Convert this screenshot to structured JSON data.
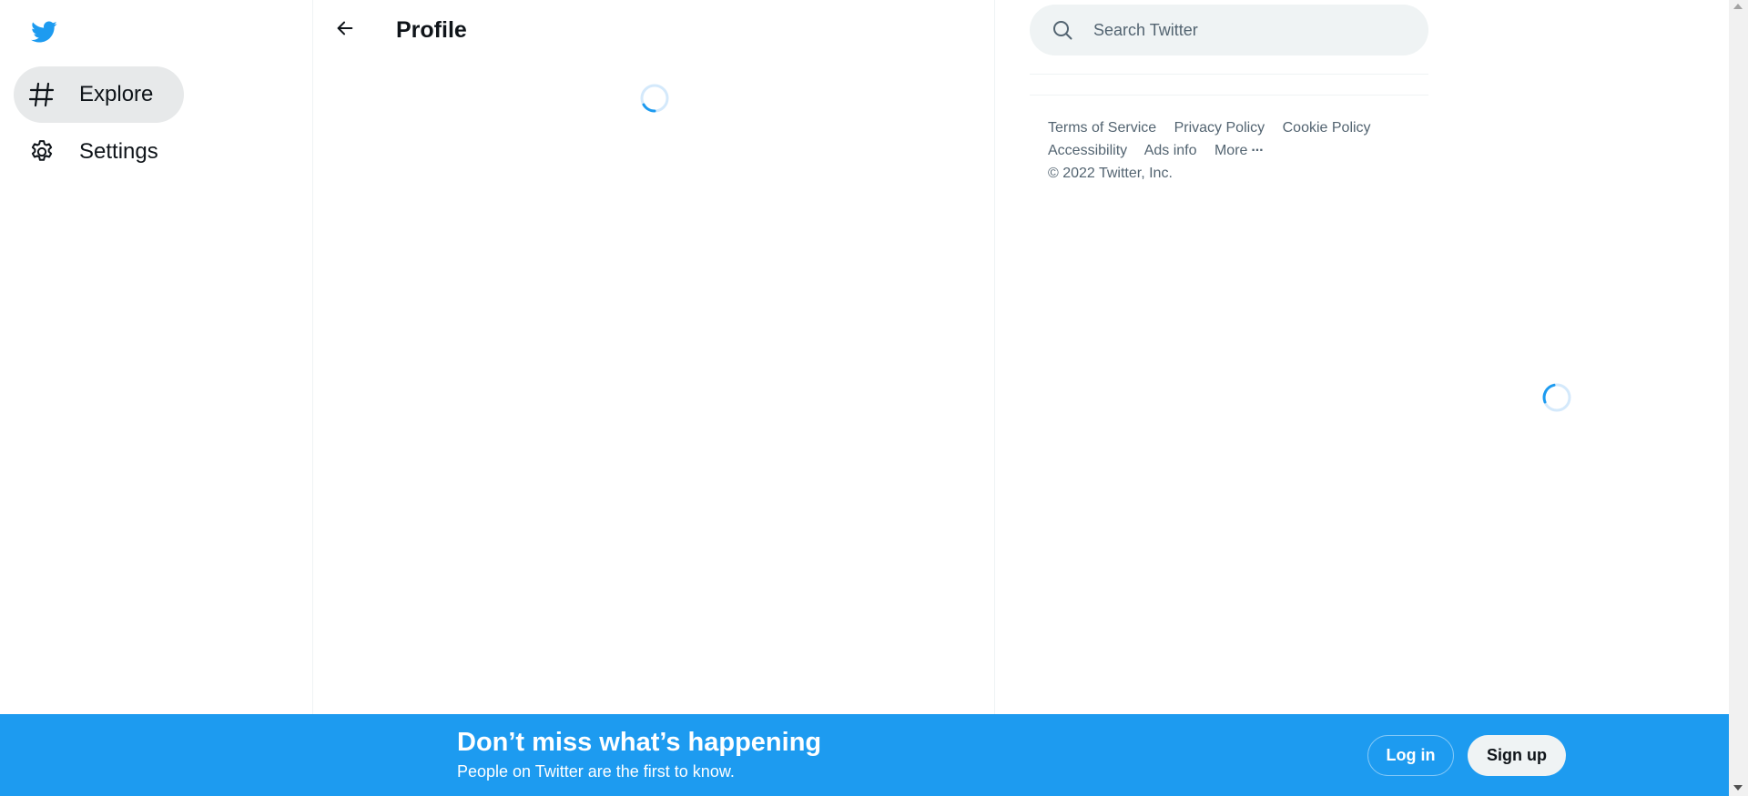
{
  "nav": {
    "logo_icon": "twitter-bird-icon",
    "items": [
      {
        "label": "Explore",
        "icon": "hashtag-icon",
        "active": true
      },
      {
        "label": "Settings",
        "icon": "gear-icon",
        "active": false
      }
    ]
  },
  "main": {
    "title": "Profile",
    "back_icon": "arrow-left-icon",
    "loading": true
  },
  "search": {
    "placeholder": "Search Twitter",
    "icon": "search-icon"
  },
  "footer": {
    "links": [
      "Terms of Service",
      "Privacy Policy",
      "Cookie Policy",
      "Accessibility",
      "Ads info"
    ],
    "more_label": "More",
    "more_icon": "ellipsis-icon",
    "copyright": "© 2022 Twitter, Inc."
  },
  "banner": {
    "title": "Don’t miss what’s happening",
    "subtitle": "People on Twitter are the first to know.",
    "login_label": "Log in",
    "signup_label": "Sign up"
  },
  "colors": {
    "brand": "#1d9bf0",
    "text": "#0f1419",
    "muted": "#536471",
    "surface": "#eff3f4"
  }
}
